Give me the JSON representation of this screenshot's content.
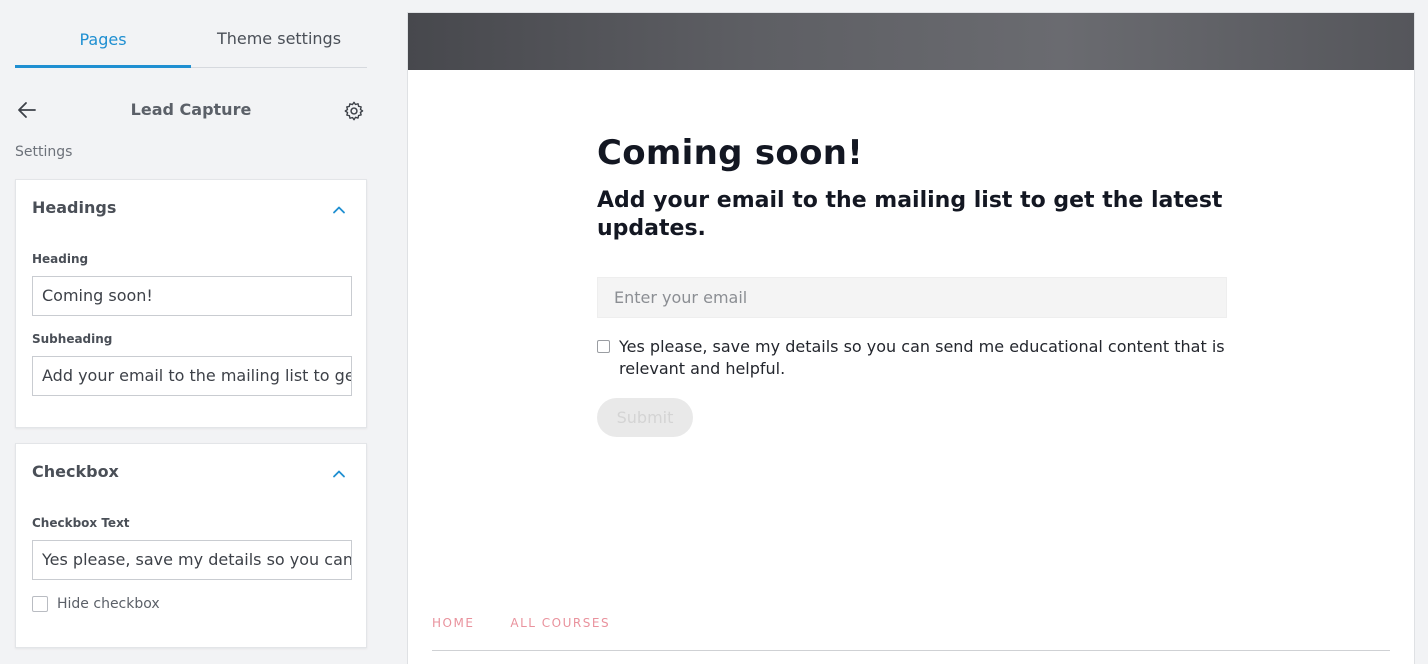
{
  "sidebar": {
    "tabs": [
      {
        "label": "Pages",
        "active": true
      },
      {
        "label": "Theme settings",
        "active": false
      }
    ],
    "page_title": "Lead Capture",
    "settings_label": "Settings",
    "headings_card": {
      "title": "Headings",
      "heading_label": "Heading",
      "heading_value": "Coming soon!",
      "subheading_label": "Subheading",
      "subheading_value": "Add your email to the mailing list to get the latest updates."
    },
    "checkbox_card": {
      "title": "Checkbox",
      "checkbox_text_label": "Checkbox Text",
      "checkbox_text_value": "Yes please, save my details so you can send me educational content that is relevant and helpful.",
      "hide_checkbox_label": "Hide checkbox",
      "hide_checkbox_checked": false
    }
  },
  "preview": {
    "headline": "Coming soon!",
    "subheadline": "Add your email to the mailing list to get the latest updates.",
    "email_placeholder": "Enter your email",
    "consent_text": "Yes please, save my details so you can send me educational content that is relevant and helpful.",
    "submit_label": "Submit",
    "footer_links": [
      "HOME",
      "ALL COURSES"
    ]
  },
  "colors": {
    "accent": "#1f8fd1",
    "footer_link": "#e9929d"
  }
}
